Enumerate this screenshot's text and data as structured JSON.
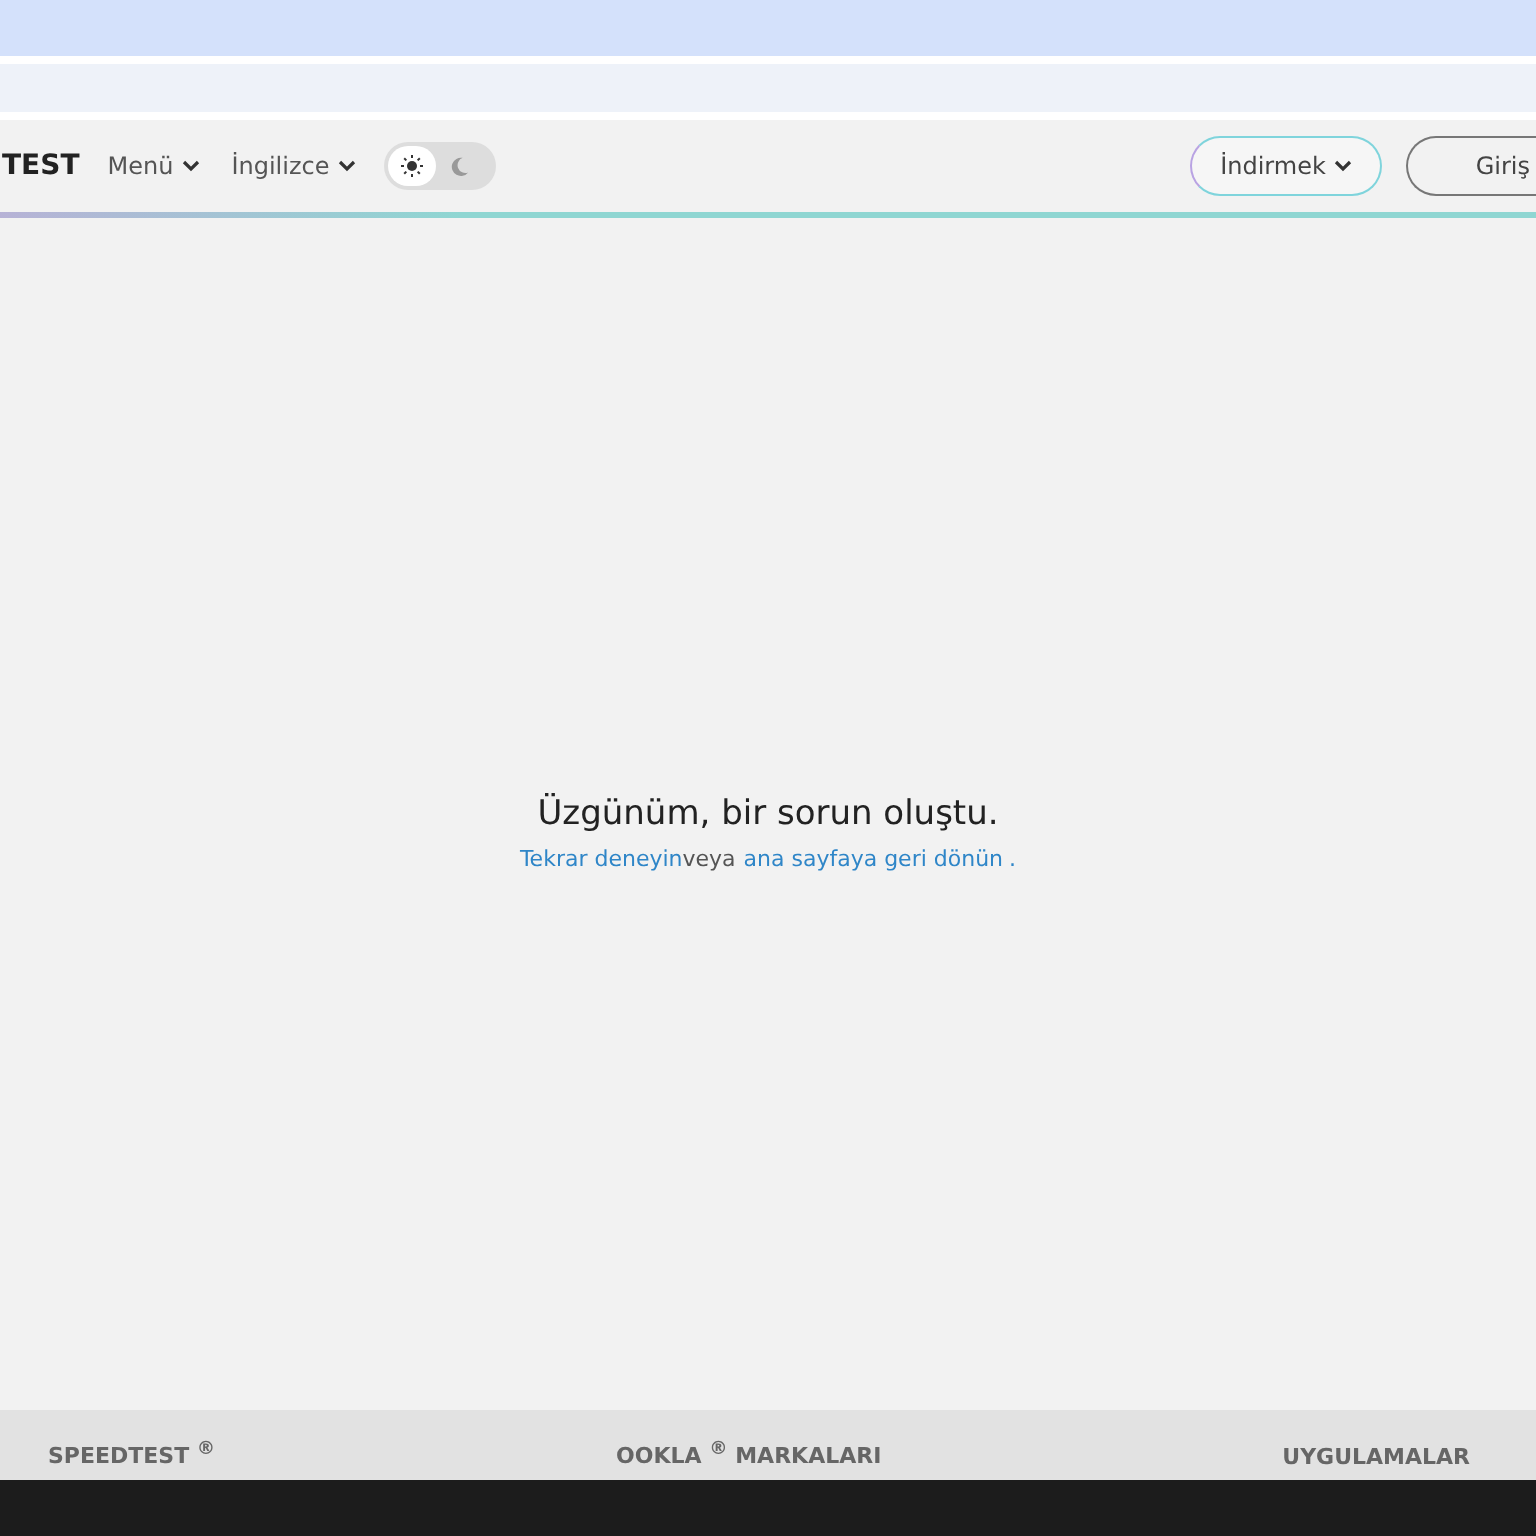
{
  "header": {
    "logo": "TEST",
    "menu": "Menü",
    "language": "İngilizce",
    "theme_toggle": {
      "dark": false
    },
    "download": "İndirmek",
    "login": "Giriş"
  },
  "error": {
    "title": "Üzgünüm, bir sorun oluştu.",
    "retry_link": "Tekrar deneyin",
    "middle": "veya",
    "home_link": "ana sayfaya geri dönün",
    "end": "."
  },
  "footer": {
    "columns": [
      "SPEEDTEST $^{®}$",
      "OOKLA $^{®}$ MARKALARI",
      "UYGULAMALAR"
    ]
  }
}
